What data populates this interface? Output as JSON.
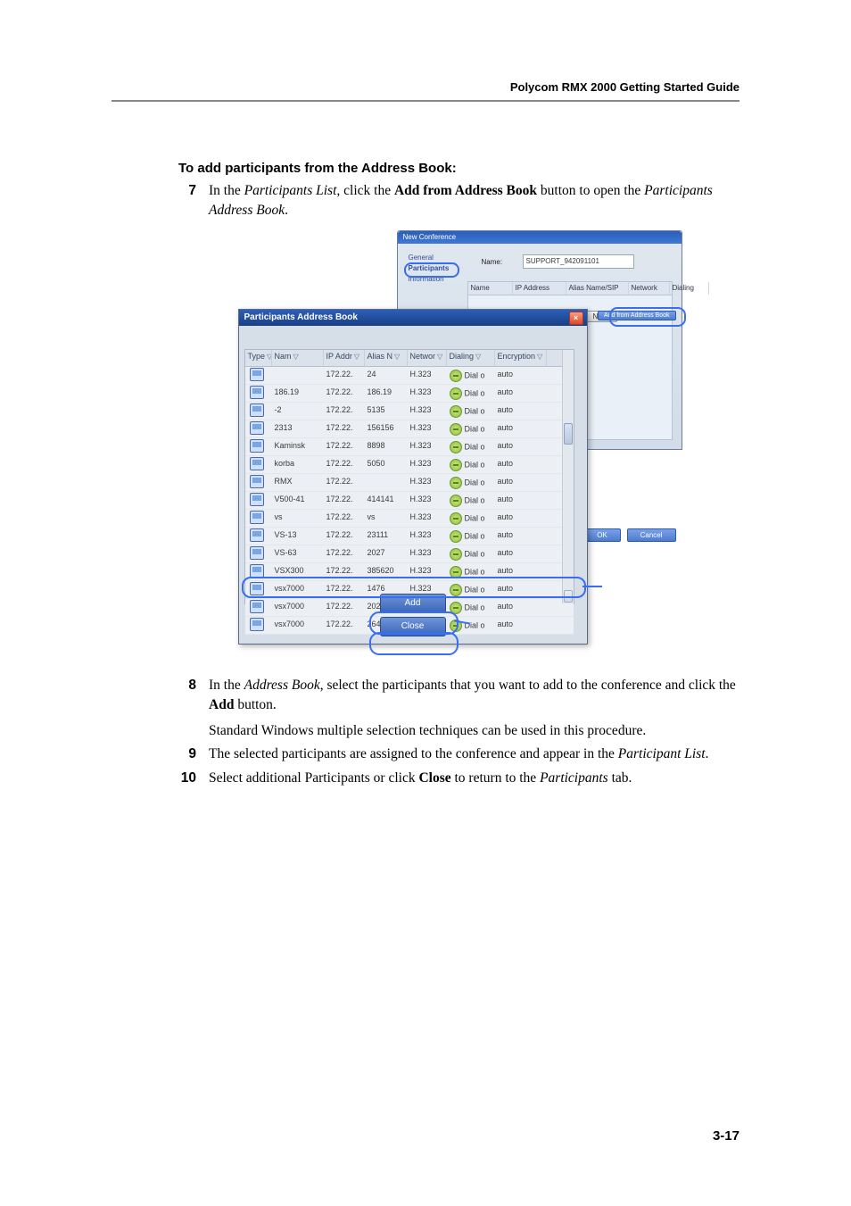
{
  "header": {
    "running": "Polycom RMX 2000 Getting Started Guide"
  },
  "headings": {
    "add_from_book": "To add participants from the Address Book:"
  },
  "steps": {
    "s7": {
      "num": "7",
      "line1_a": "In the ",
      "line1_i1": "Participants List,",
      "line1_b": " click the ",
      "line1_bold": "Add from Address Book",
      "line1_c": " button to open the ",
      "line1_i2": "Participants Address Book",
      "line1_d": "."
    },
    "s8": {
      "num": "8",
      "line1_a": "In the ",
      "line1_i": "Address Book",
      "line1_b": ", select the participants that you want to add to the conference and click the ",
      "line1_bold": "Add",
      "line1_c": " button.",
      "follow": "Standard Windows multiple selection techniques can be used in this procedure."
    },
    "s9": {
      "num": "9",
      "line_a": "The selected participants are assigned to the conference and appear in the ",
      "line_i": "Participant List",
      "line_c": "."
    },
    "s10": {
      "num": "10",
      "line_a": "Select additional Participants or click ",
      "line_bold": "Close",
      "line_b": " to return to the ",
      "line_i": "Participants",
      "line_c": " tab."
    }
  },
  "back_window": {
    "title": "New Conference",
    "side_items": [
      "General",
      "Participants",
      "Information"
    ],
    "name_label": "Name:",
    "name_value": "SUPPORT_942091101",
    "cols": [
      "Name",
      "IP Address",
      "Alias Name/SIP",
      "Network",
      "Dialing"
    ],
    "btn_new": "New",
    "btn_addr": "Add from Address Book",
    "lecturer_value": "",
    "btn_ok": "OK",
    "btn_cancel": "Cancel"
  },
  "front_window": {
    "title": "Participants Address Book",
    "close": "×",
    "cols": [
      "Type",
      "Nam",
      "IP Addr",
      "Alias N",
      "Networ",
      "Dialing",
      "Encryption"
    ],
    "filter_glyph": "▽",
    "rows": [
      {
        "name": "",
        "ip": "172.22.",
        "alias": "24",
        "net": "H.323",
        "dial": "Dial o",
        "enc": "auto"
      },
      {
        "name": "186.19",
        "ip": "172.22.",
        "alias": "186.19",
        "net": "H.323",
        "dial": "Dial o",
        "enc": "auto"
      },
      {
        "name": "-2",
        "ip": "172.22.",
        "alias": "5135",
        "net": "H.323",
        "dial": "Dial o",
        "enc": "auto"
      },
      {
        "name": "2313",
        "ip": "172.22.",
        "alias": "156156",
        "net": "H.323",
        "dial": "Dial o",
        "enc": "auto"
      },
      {
        "name": "Kaminsk",
        "ip": "172.22.",
        "alias": "8898",
        "net": "H.323",
        "dial": "Dial o",
        "enc": "auto"
      },
      {
        "name": "korba",
        "ip": "172.22.",
        "alias": "5050",
        "net": "H.323",
        "dial": "Dial o",
        "enc": "auto"
      },
      {
        "name": "RMX",
        "ip": "172.22.",
        "alias": "",
        "net": "H.323",
        "dial": "Dial o",
        "enc": "auto"
      },
      {
        "name": "V500-41",
        "ip": "172.22.",
        "alias": "414141",
        "net": "H.323",
        "dial": "Dial o",
        "enc": "auto"
      },
      {
        "name": "vs",
        "ip": "172.22.",
        "alias": "vs",
        "net": "H.323",
        "dial": "Dial o",
        "enc": "auto"
      },
      {
        "name": "VS-13",
        "ip": "172.22.",
        "alias": "23111",
        "net": "H.323",
        "dial": "Dial o",
        "enc": "auto"
      },
      {
        "name": "VS-63",
        "ip": "172.22.",
        "alias": "2027",
        "net": "H.323",
        "dial": "Dial o",
        "enc": "auto"
      },
      {
        "name": "VSX300",
        "ip": "172.22.",
        "alias": "385620",
        "net": "H.323",
        "dial": "Dial o",
        "enc": "auto"
      },
      {
        "name": "vsx7000",
        "ip": "172.22.",
        "alias": "1476",
        "net": "H.323",
        "dial": "Dial o",
        "enc": "auto"
      },
      {
        "name": "vsx7000",
        "ip": "172.22.",
        "alias": "202020",
        "net": "H.323",
        "dial": "Dial o",
        "enc": "auto"
      },
      {
        "name": "vsx7000",
        "ip": "172.22.",
        "alias": "2646",
        "net": "H.323",
        "dial": "Dial o",
        "enc": "auto"
      }
    ],
    "btn_add": "Add",
    "btn_close": "Close"
  },
  "footer": {
    "page": "3-17"
  }
}
